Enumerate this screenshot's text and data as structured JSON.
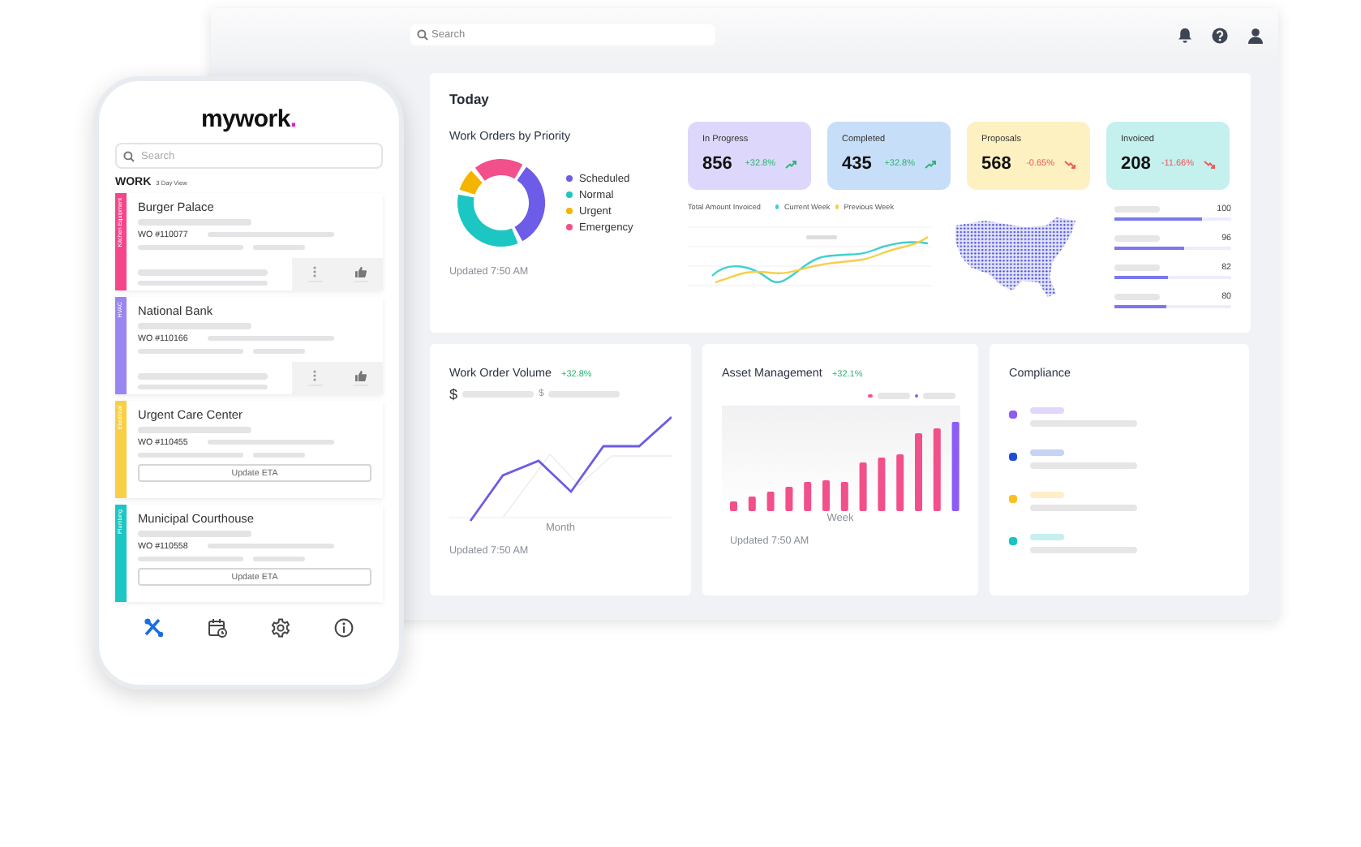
{
  "dashboard": {
    "search": {
      "placeholder": "Search"
    },
    "today": {
      "title": "Today",
      "priority": {
        "title": "Work Orders by Priority",
        "updated": "Updated 7:50 AM",
        "legend": [
          {
            "label": "Scheduled",
            "color": "#6c5ce7"
          },
          {
            "label": "Normal",
            "color": "#1cc6c2"
          },
          {
            "label": "Urgent",
            "color": "#f5b400"
          },
          {
            "label": "Emergency",
            "color": "#f2508a"
          }
        ]
      },
      "stats": [
        {
          "label": "In Progress",
          "value": "856",
          "change": "+32.8%",
          "rising": true,
          "color": "#ddd8fb"
        },
        {
          "label": "Completed",
          "value": "435",
          "change": "+32.8%",
          "rising": true,
          "color": "#c6def8"
        },
        {
          "label": "Proposals",
          "value": "568",
          "change": "-0.65%",
          "rising": false,
          "color": "#fdf1c2"
        },
        {
          "label": "Invoiced",
          "value": "208",
          "change": "-11.66%",
          "rising": false,
          "color": "#c4f0ee"
        }
      ],
      "invoiced_chart": {
        "title": "Total Amount Invoiced",
        "legend": [
          {
            "label": "Current Week",
            "color": "#3fd0cf"
          },
          {
            "label": "Previous Week",
            "color": "#f7cf4a"
          }
        ]
      },
      "progress": [
        {
          "value": "100",
          "level": 0.75
        },
        {
          "value": "96",
          "level": 0.6
        },
        {
          "value": "82",
          "level": 0.46
        },
        {
          "value": "80",
          "level": 0.45
        }
      ]
    },
    "volume": {
      "title": "Work Order Volume",
      "change": "+32.8%",
      "currency": "$",
      "currency_2": "$",
      "xlabel": "Month",
      "updated": "Updated 7:50 AM"
    },
    "assets": {
      "title": "Asset Management",
      "change": "+32.1%",
      "xlabel": "Week",
      "updated": "Updated 7:50 AM",
      "legend": [
        {
          "color": "#f2508a"
        },
        {
          "color": "#8b5cf6"
        }
      ]
    },
    "compliance": {
      "title": "Compliance",
      "items": [
        {
          "color": "#8b5cf6"
        },
        {
          "color": "#1d4ed8"
        },
        {
          "color": "#fbbf24"
        },
        {
          "color": "#16c4c0"
        }
      ]
    }
  },
  "phone": {
    "logo": "mywork",
    "logo_dot": ".",
    "search": {
      "placeholder": "Search"
    },
    "section": "WORK",
    "section_note": "3 Day View",
    "orders": [
      {
        "category": "Kitchen Equipment",
        "color": "#f5468a",
        "name": "Burger Palace",
        "number": "WO #110077",
        "kind": "actions"
      },
      {
        "category": "HVAC",
        "color": "#9a86f2",
        "name": "National Bank",
        "number": "WO #110166",
        "kind": "actions"
      },
      {
        "category": "Electrical",
        "color": "#f9cf45",
        "name": "Urgent Care Center",
        "number": "WO #110455",
        "kind": "eta",
        "button": "Update ETA"
      },
      {
        "category": "Plumbing",
        "color": "#1cc6c2",
        "name": "Municipal Courthouse",
        "number": "WO #110558",
        "kind": "eta",
        "button": "Update ETA"
      }
    ],
    "nav": [
      {
        "kind": "tools",
        "selected": true
      },
      {
        "kind": "calendar",
        "selected": false
      },
      {
        "kind": "settings",
        "selected": false
      },
      {
        "kind": "info",
        "selected": false
      }
    ]
  }
}
